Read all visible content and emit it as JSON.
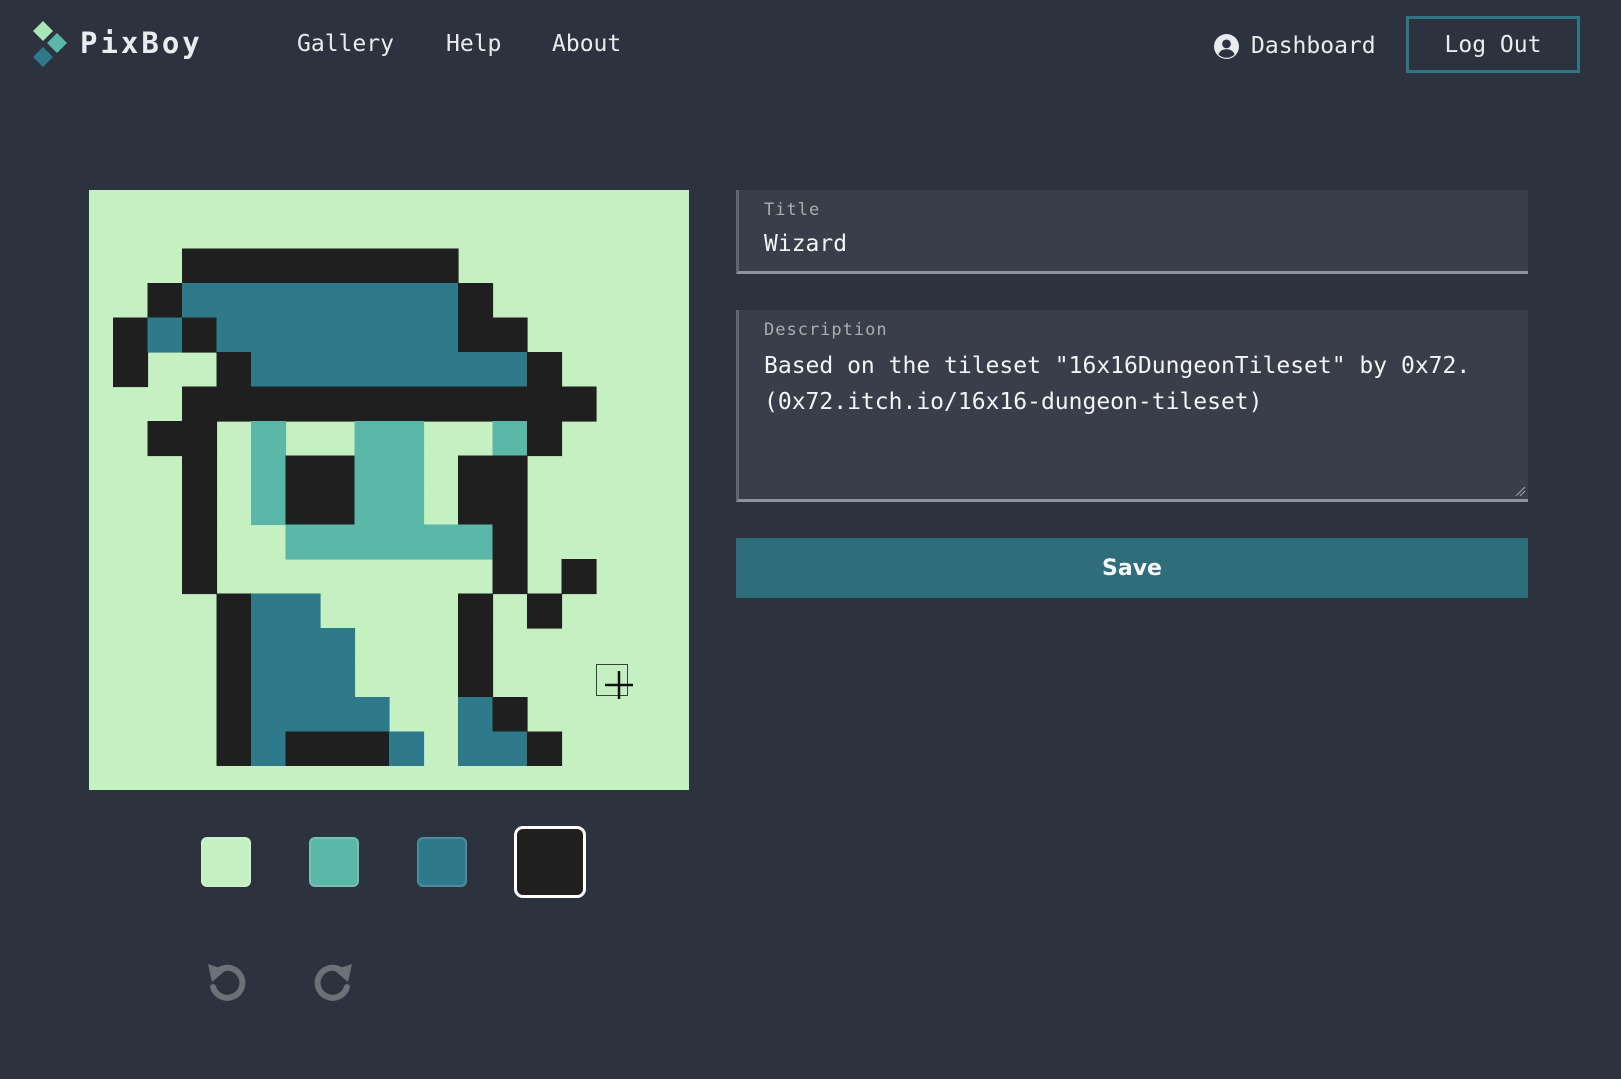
{
  "app": {
    "brand": "PixBoy"
  },
  "nav": {
    "gallery": "Gallery",
    "help": "Help",
    "about": "About"
  },
  "user": {
    "dashboard": "Dashboard",
    "logout": "Log Out",
    "user_icon": "user-circle-icon"
  },
  "form": {
    "title_label": "Title",
    "title_value": "Wizard",
    "description_label": "Description",
    "description_value": "Based on the tileset \"16x16DungeonTileset\" by 0x72.\n(0x72.itch.io/16x16-dungeon-tileset)",
    "save_label": "Save"
  },
  "palette": {
    "colors": [
      "#c5f0c2",
      "#5bb8a8",
      "#2e7a8a",
      "#1f1f1f"
    ],
    "selected_index": 3
  },
  "history": {
    "undo_icon": "undo-icon",
    "redo_icon": "redo-icon"
  },
  "theme": {
    "background": "#2d333e",
    "field_background": "#383e4a",
    "accent": "#2e6e7b"
  },
  "pixel_art": [
    "................",
    "..########......",
    ".#22222222#.....",
    "#2#2222222##....",
    "#..#22222222#...",
    "..############..",
    ".##.1..11..1#...",
    "..#.1##11.##....",
    "..#.1##11.##....",
    "..#..111111#....",
    "..#........#.#..",
    "...#22....#.#...",
    "...#222...#.....",
    "...#222...#.....",
    "...#2222..2#....",
    "...#2###2.22#...",
    "...####.####....",
    "................"
  ]
}
